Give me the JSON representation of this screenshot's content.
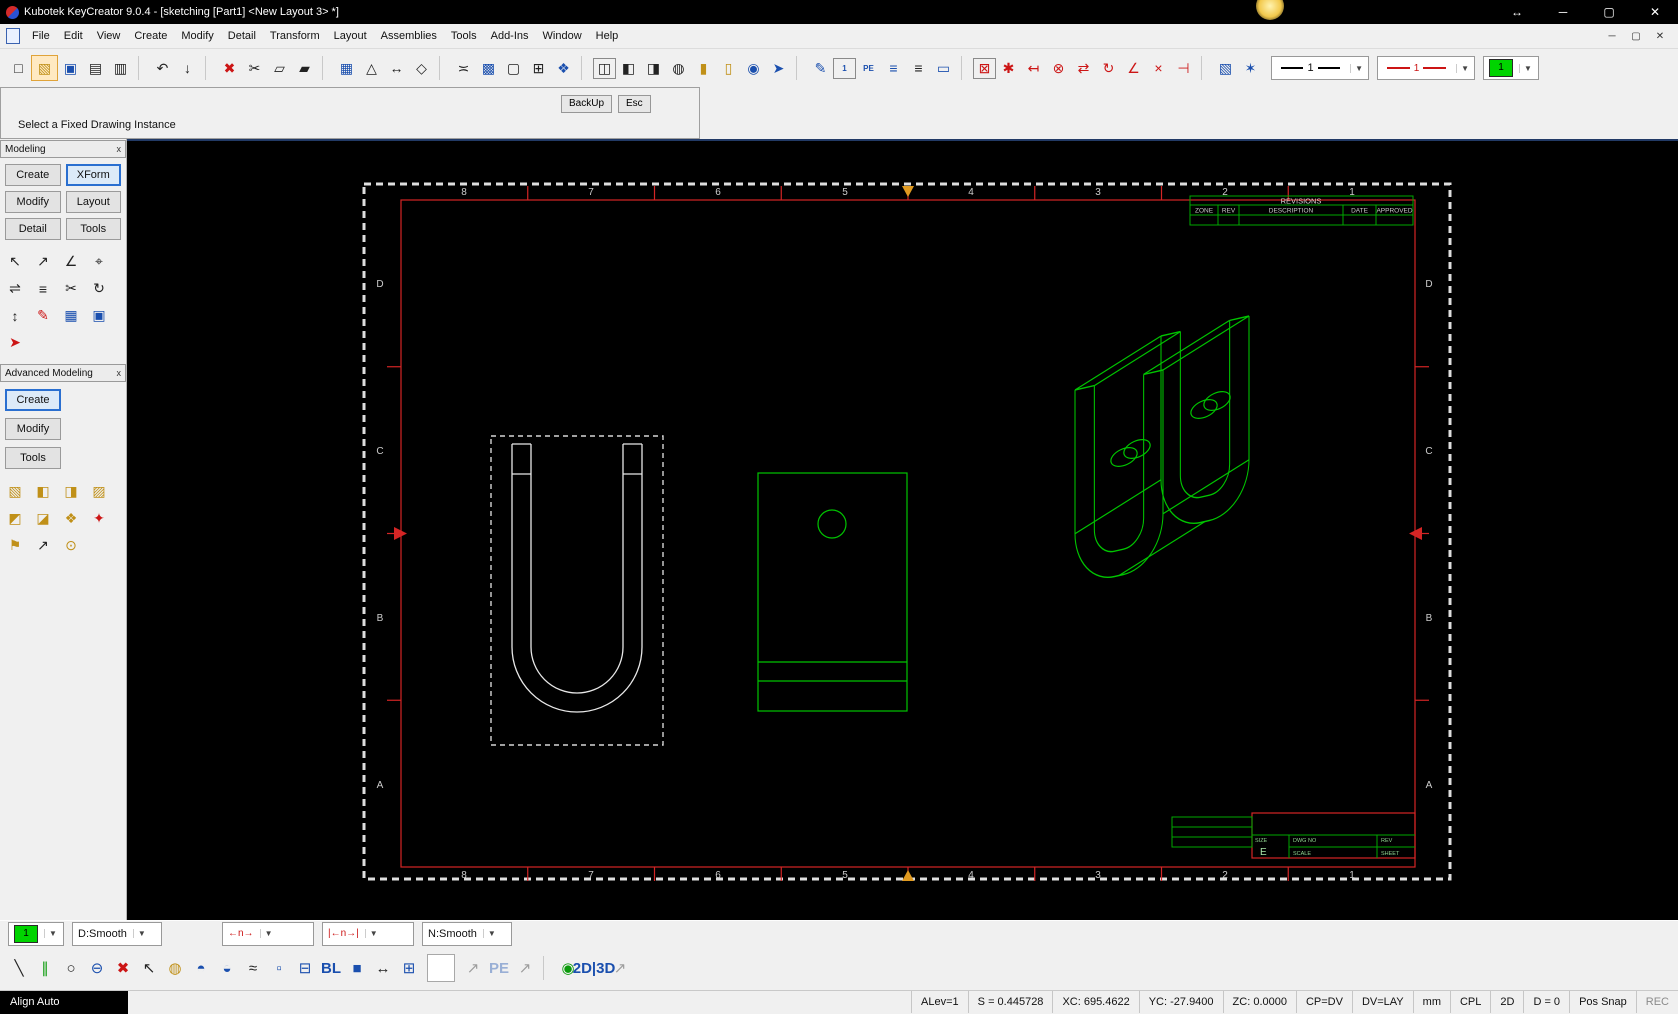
{
  "window": {
    "title": "Kubotek KeyCreator 9.0.4 - [sketching [Part1] <New Layout 3> *]",
    "controls": {
      "dock": "↔",
      "minimize": "─",
      "maximize": "▢",
      "close": "✕"
    }
  },
  "menu": {
    "items": [
      "File",
      "Edit",
      "View",
      "Create",
      "Modify",
      "Detail",
      "Transform",
      "Layout",
      "Assemblies",
      "Tools",
      "Add-Ins",
      "Window",
      "Help"
    ],
    "mdi_controls": {
      "minimize": "─",
      "restore": "▢",
      "close": "✕"
    }
  },
  "toolbar": {
    "line_width_value": "1",
    "line_color_value": "1",
    "color_value": "1",
    "icons": [
      {
        "n": "new-file-icon",
        "g": "□"
      },
      {
        "n": "open-file-icon",
        "g": "▧",
        "c": "yellow hl"
      },
      {
        "n": "save-file-icon",
        "g": "▣",
        "c": "blue"
      },
      {
        "n": "print-icon",
        "g": "▤"
      },
      {
        "n": "print-preview-icon",
        "g": "▥"
      },
      {
        "sep": true
      },
      {
        "n": "undo-icon",
        "g": "↶"
      },
      {
        "n": "import-icon",
        "g": "↓"
      },
      {
        "sep": true
      },
      {
        "n": "delete-icon",
        "g": "✖",
        "c": "red"
      },
      {
        "n": "cut-icon",
        "g": "✂"
      },
      {
        "n": "copy-icon",
        "g": "▱"
      },
      {
        "n": "paste-icon",
        "g": "▰"
      },
      {
        "sep": true
      },
      {
        "n": "array-icon",
        "g": "▦",
        "c": "blue"
      },
      {
        "n": "triangle-icon",
        "g": "△"
      },
      {
        "n": "stretch-icon",
        "g": "↔"
      },
      {
        "n": "polygon-icon",
        "g": "◇"
      },
      {
        "sep": true
      },
      {
        "n": "chain-select-icon",
        "g": "≍"
      },
      {
        "n": "picture-icon",
        "g": "▩",
        "c": "blue"
      },
      {
        "n": "zoom-window-icon",
        "g": "▢"
      },
      {
        "n": "zoom-extents-icon",
        "g": "⊞"
      },
      {
        "n": "pan-icon",
        "g": "❖",
        "c": "blue"
      },
      {
        "sep": true
      },
      {
        "n": "iso-view-icon",
        "g": "◫",
        "c": "boxed"
      },
      {
        "n": "view-front-icon",
        "g": "◧"
      },
      {
        "n": "view-side-icon",
        "g": "◨"
      },
      {
        "n": "view-top-icon",
        "g": "◍"
      },
      {
        "n": "extrude-icon",
        "g": "▮",
        "c": "yellow"
      },
      {
        "n": "sheet-icon",
        "g": "▯",
        "c": "yellow"
      },
      {
        "n": "globe-icon",
        "g": "◉",
        "c": "blue"
      },
      {
        "n": "pointer-icon",
        "g": "➤",
        "c": "blue"
      },
      {
        "sep": true
      },
      {
        "n": "sketch-icon",
        "g": "✎",
        "c": "blue"
      },
      {
        "n": "level-display-icon",
        "g": "1",
        "c": "txt boxed"
      },
      {
        "n": "pevue-icon",
        "g": "PE",
        "c": "txt"
      },
      {
        "n": "level-up-icon",
        "g": "≡",
        "c": "blue"
      },
      {
        "n": "level-down-icon",
        "g": "≡"
      },
      {
        "n": "monitor-icon",
        "g": "▭",
        "c": "blue"
      },
      {
        "sep": true
      },
      {
        "n": "snap-origin-icon",
        "g": "⊠",
        "c": "red boxed"
      },
      {
        "n": "snap-point-icon",
        "g": "✱",
        "c": "red"
      },
      {
        "n": "snap-end-icon",
        "g": "↤",
        "c": "red"
      },
      {
        "n": "snap-center-icon",
        "g": "⊗",
        "c": "red"
      },
      {
        "n": "snap-mid-icon",
        "g": "⇄",
        "c": "red"
      },
      {
        "n": "snap-tangent-icon",
        "g": "↻",
        "c": "red"
      },
      {
        "n": "snap-angle-icon",
        "g": "∠",
        "c": "red"
      },
      {
        "n": "snap-intersect-icon",
        "g": "×",
        "c": "red"
      },
      {
        "n": "snap-perp-icon",
        "g": "⊣",
        "c": "red"
      },
      {
        "sep": true
      },
      {
        "n": "view-cube-icon",
        "g": "▧",
        "c": "blue"
      },
      {
        "n": "settings-icon",
        "g": "✶",
        "c": "blue"
      }
    ]
  },
  "prompt": {
    "message": "Select a Fixed Drawing Instance",
    "backup": "BackUp",
    "esc": "Esc"
  },
  "panels": {
    "modeling": {
      "title": "Modeling",
      "close": "x",
      "tabs": [
        "Create",
        "XForm",
        "Modify",
        "Layout",
        "Detail",
        "Tools"
      ],
      "active_tab": "XForm",
      "icons": [
        {
          "n": "xform-dynamic-icon",
          "g": "↖"
        },
        {
          "n": "xform-translate-icon",
          "g": "↗"
        },
        {
          "n": "xform-rotate-icon",
          "g": "∠"
        },
        {
          "n": "xform-scale-icon",
          "g": "⌖"
        },
        {
          "n": "xform-mirror-icon",
          "g": "⇌"
        },
        {
          "n": "xform-offset-icon",
          "g": "≡"
        },
        {
          "n": "xform-break-icon",
          "g": "✂"
        },
        {
          "n": "xform-spin-icon",
          "g": "↻"
        },
        {
          "n": "xform-stretch-icon",
          "g": "↕"
        },
        {
          "n": "xform-paint-icon",
          "g": "✎",
          "c": "red"
        },
        {
          "n": "xform-array-icon",
          "g": "▦",
          "c": "blue"
        },
        {
          "n": "xform-project-icon",
          "g": "▣",
          "c": "blue"
        },
        {
          "n": "xform-select-icon",
          "g": "➤",
          "c": "red"
        }
      ]
    },
    "advanced": {
      "title": "Advanced Modeling",
      "close": "x",
      "buttons": [
        "Create",
        "Modify",
        "Tools"
      ],
      "active_button": "Create",
      "icons": [
        {
          "n": "adv-block-icon",
          "g": "▧",
          "c": "yellow"
        },
        {
          "n": "adv-extrude-icon",
          "g": "◧",
          "c": "yellow"
        },
        {
          "n": "adv-sweep-icon",
          "g": "◨",
          "c": "yellow"
        },
        {
          "n": "adv-mesh-icon",
          "g": "▨",
          "c": "yellow"
        },
        {
          "n": "adv-solid-add-icon",
          "g": "◩",
          "c": "yellow"
        },
        {
          "n": "adv-solid-cut-icon",
          "g": "◪",
          "c": "yellow"
        },
        {
          "n": "adv-boolean-icon",
          "g": "❖",
          "c": "yellow"
        },
        {
          "n": "adv-draft-icon",
          "g": "✦",
          "c": "red"
        },
        {
          "n": "adv-flag-icon",
          "g": "⚑",
          "c": "yellow"
        },
        {
          "n": "adv-pick-icon",
          "g": "↗"
        },
        {
          "n": "adv-datum-icon",
          "g": "⊙",
          "c": "yellow"
        }
      ]
    }
  },
  "drawing": {
    "zone_columns": [
      "8",
      "7",
      "6",
      "5",
      "4",
      "3",
      "2",
      "1"
    ],
    "zone_rows": [
      "D",
      "C",
      "B",
      "A"
    ],
    "revisions": {
      "title": "REVISIONS",
      "headers": [
        "ZONE",
        "REV",
        "DESCRIPTION",
        "DATE",
        "APPROVED"
      ]
    },
    "titleblock": {
      "size_label": "SIZE",
      "size_value": "E",
      "dwg_label": "DWG NO",
      "rev_label": "REV",
      "scale_label": "SCALE",
      "sheet_label": "SHEET"
    }
  },
  "bottom": {
    "color_value": "1",
    "d_smooth": "D:Smooth",
    "arrow1": "←n→",
    "arrow2": "|←n→|",
    "n_smooth": "N:Smooth",
    "icons": [
      {
        "n": "line-tool-icon",
        "g": "╲"
      },
      {
        "n": "parallel-tool-icon",
        "g": "∥",
        "c": "green"
      },
      {
        "n": "circle-tool-icon",
        "g": "○"
      },
      {
        "n": "ellipse-tool-icon",
        "g": "⊖",
        "c": "blue"
      },
      {
        "n": "delete-tool-icon",
        "g": "✖",
        "c": "red"
      },
      {
        "n": "leader-tool-icon",
        "g": "↖"
      },
      {
        "n": "cylinder-tool-icon",
        "g": "◍",
        "c": "yellow"
      },
      {
        "n": "ellipse-blue1-icon",
        "g": "◓",
        "c": "blue"
      },
      {
        "n": "ellipse-blue2-icon",
        "g": "◒",
        "c": "blue"
      },
      {
        "n": "spline-tool-icon",
        "g": "≈"
      },
      {
        "n": "rect-tool-icon",
        "g": "▫",
        "c": "blue"
      },
      {
        "n": "corner-tool-icon",
        "g": "⊟",
        "c": "blue"
      },
      {
        "n": "bl-tool-icon",
        "g": "BL",
        "c": "txt"
      },
      {
        "n": "fill-tool-icon",
        "g": "■",
        "c": "blue"
      },
      {
        "n": "stretch-tool-icon",
        "g": "↔"
      },
      {
        "n": "split-tool-icon",
        "g": "⊞",
        "c": "blue"
      },
      {
        "n": "empty-swatch",
        "g": "",
        "c": "blank",
        "ni": true
      },
      {
        "n": "pick-tool-icon",
        "g": "↗",
        "c": "dim"
      },
      {
        "n": "pevue-tool-icon",
        "g": "PE",
        "c": "txt dim"
      },
      {
        "n": "pick-tool2-icon",
        "g": "↗",
        "c": "dim"
      },
      {
        "sep": true
      },
      {
        "n": "globe-tool-icon",
        "g": "◉",
        "c": "green"
      },
      {
        "n": "mode-2d3d-icon",
        "g": "2D|3D",
        "c": "txt"
      },
      {
        "n": "pick-tool3-icon",
        "g": "↗",
        "c": "dim"
      }
    ]
  },
  "status": {
    "align": "Align Auto",
    "segments": [
      {
        "n": "alev",
        "t": "ALev=1"
      },
      {
        "n": "scale",
        "t": "S = 0.445728"
      },
      {
        "n": "xc",
        "t": "XC: 695.4622"
      },
      {
        "n": "yc",
        "t": "YC: -27.9400"
      },
      {
        "n": "zc",
        "t": "ZC: 0.0000"
      },
      {
        "n": "cp",
        "t": "CP=DV"
      },
      {
        "n": "dv",
        "t": "DV=LAY"
      },
      {
        "n": "units",
        "t": "mm"
      },
      {
        "n": "cpl",
        "t": "CPL"
      },
      {
        "n": "mode",
        "t": "2D"
      },
      {
        "n": "depth",
        "t": "D = 0"
      },
      {
        "n": "snap",
        "t": "Pos Snap"
      },
      {
        "n": "rec",
        "t": "REC"
      }
    ]
  }
}
